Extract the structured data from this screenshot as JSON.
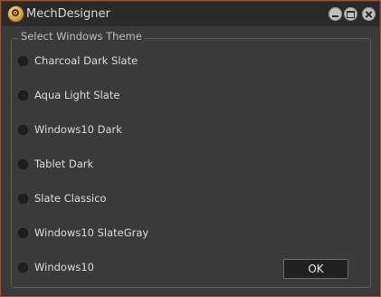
{
  "window": {
    "title": "MechDesigner",
    "icon": "mechdesigner-app-icon",
    "controls": [
      "minimize-icon",
      "maximize-icon",
      "close-icon"
    ]
  },
  "group": {
    "legend": "Select Windows Theme"
  },
  "themes": [
    {
      "label": "Charcoal Dark Slate",
      "selected": false
    },
    {
      "label": "Aqua Light Slate",
      "selected": false
    },
    {
      "label": "Windows10 Dark",
      "selected": false
    },
    {
      "label": "Tablet Dark",
      "selected": false
    },
    {
      "label": "Slate Classico",
      "selected": false
    },
    {
      "label": "Windows10 SlateGray",
      "selected": false
    },
    {
      "label": "Windows10",
      "selected": false
    }
  ],
  "buttons": {
    "ok_label": "OK"
  },
  "colors": {
    "window_border": "#a0522d",
    "background": "#3a3a3a",
    "titlebar": "#2a2a2a",
    "text": "#dcdcdc"
  }
}
